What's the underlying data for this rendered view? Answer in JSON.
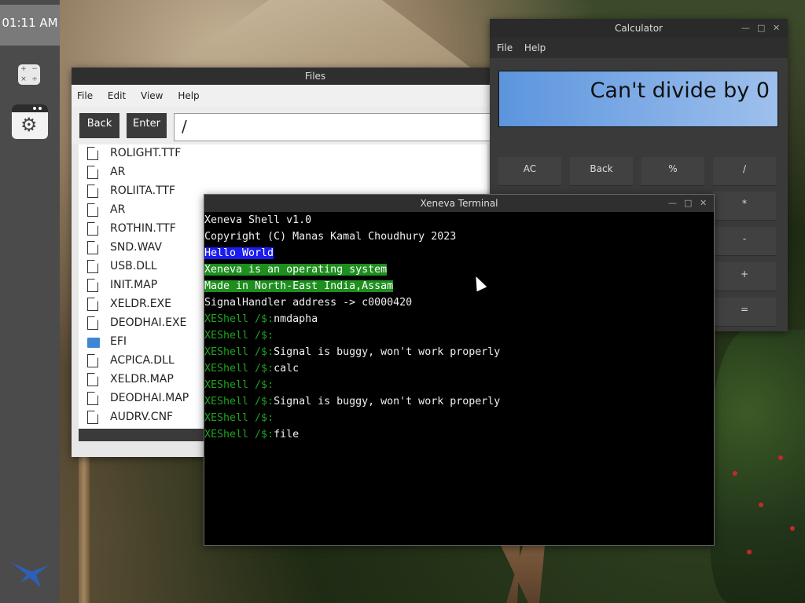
{
  "taskbar": {
    "time": "01:11 AM",
    "calc_icon_glyphs": [
      "+",
      "−",
      "×",
      "÷"
    ]
  },
  "files": {
    "title": "Files",
    "menu": [
      "File",
      "Edit",
      "View",
      "Help"
    ],
    "back_label": "Back",
    "enter_label": "Enter",
    "path": "/",
    "items": [
      {
        "name": "ROLIGHT.TTF",
        "type": "file"
      },
      {
        "name": "AR",
        "type": "file"
      },
      {
        "name": "ROLIITA.TTF",
        "type": "file"
      },
      {
        "name": "AR",
        "type": "file"
      },
      {
        "name": "ROTHIN.TTF",
        "type": "file"
      },
      {
        "name": "SND.WAV",
        "type": "file"
      },
      {
        "name": "USB.DLL",
        "type": "file"
      },
      {
        "name": "INIT.MAP",
        "type": "file"
      },
      {
        "name": "XELDR.EXE",
        "type": "file"
      },
      {
        "name": "DEODHAI.EXE",
        "type": "file"
      },
      {
        "name": "EFI",
        "type": "folder"
      },
      {
        "name": "ACPICA.DLL",
        "type": "file"
      },
      {
        "name": "XELDR.MAP",
        "type": "file"
      },
      {
        "name": "DEODHAI.MAP",
        "type": "file"
      },
      {
        "name": "AUDRV.CNF",
        "type": "file"
      }
    ]
  },
  "calculator": {
    "title": "Calculator",
    "menu": [
      "File",
      "Help"
    ],
    "display": "Can't divide by 0",
    "buttons": [
      "AC",
      "Back",
      "%",
      "/",
      "*",
      "-",
      "+",
      "="
    ]
  },
  "terminal": {
    "title": "Xeneva Terminal",
    "prompt": "XEShell /$:",
    "lines": [
      {
        "text": "Xeneva Shell v1.0",
        "style": "plain"
      },
      {
        "text": "Copyright (C) Manas Kamal Choudhury 2023",
        "style": "plain"
      },
      {
        "text": "Hello World",
        "style": "blue"
      },
      {
        "text": "Xeneva is an operating system",
        "style": "green"
      },
      {
        "text": "Made in North-East India,Assam",
        "style": "green"
      },
      {
        "text": "SignalHandler address -> c0000420",
        "style": "plain"
      },
      {
        "text": "nmdapha",
        "style": "prompt"
      },
      {
        "text": "",
        "style": "prompt"
      },
      {
        "text": "Signal is buggy, won't work properly",
        "style": "prompt"
      },
      {
        "text": "calc",
        "style": "prompt"
      },
      {
        "text": "",
        "style": "prompt"
      },
      {
        "text": "Signal is buggy, won't work properly",
        "style": "prompt"
      },
      {
        "text": "",
        "style": "prompt"
      },
      {
        "text": "file",
        "style": "prompt"
      }
    ]
  },
  "colors": {
    "taskbar": "#4b4b4b",
    "prompt_green": "#1fa31f",
    "highlight_blue": "#1c1cf0",
    "highlight_green": "#1e8e1e",
    "calc_display": "#5c95de",
    "folder_blue": "#3f86d6"
  }
}
